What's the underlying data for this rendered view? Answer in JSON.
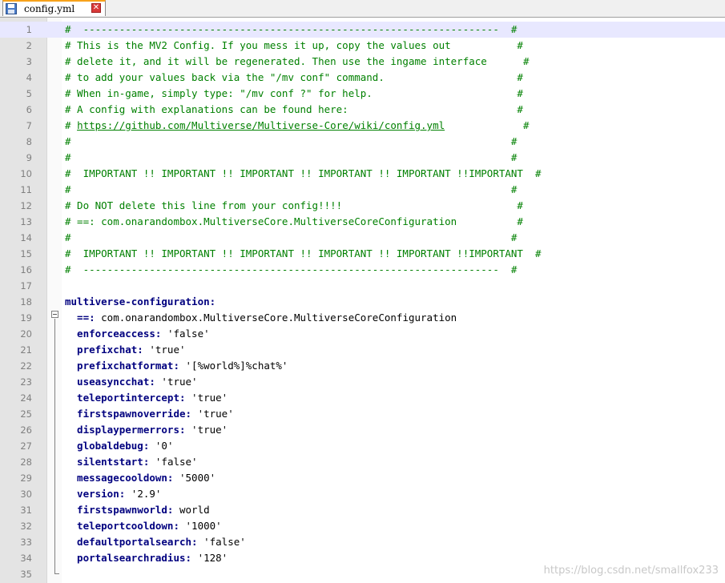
{
  "tab": {
    "filename": "config.yml",
    "close_glyph": "✕"
  },
  "lines": [
    {
      "n": "1",
      "segs": [
        [
          "c",
          "#  ---------------------------------------------------------------------  #"
        ]
      ]
    },
    {
      "n": "2",
      "segs": [
        [
          "c",
          "# This is the MV2 Config. If you mess it up, copy the values out           #"
        ]
      ]
    },
    {
      "n": "3",
      "segs": [
        [
          "c",
          "# delete it, and it will be regenerated. Then use the ingame interface      #"
        ]
      ]
    },
    {
      "n": "4",
      "segs": [
        [
          "c",
          "# to add your values back via the \"/mv conf\" command.                      #"
        ]
      ]
    },
    {
      "n": "5",
      "segs": [
        [
          "c",
          "# When in-game, simply type: \"/mv conf ?\" for help.                        #"
        ]
      ]
    },
    {
      "n": "6",
      "segs": [
        [
          "c",
          "# A config with explanations can be found here:                            #"
        ]
      ]
    },
    {
      "n": "7",
      "segs": [
        [
          "c",
          "# "
        ],
        [
          "link",
          "https://github.com/Multiverse/Multiverse-Core/wiki/config.yml"
        ],
        [
          "c",
          "             #"
        ]
      ]
    },
    {
      "n": "8",
      "segs": [
        [
          "c",
          "#                                                                         #"
        ]
      ]
    },
    {
      "n": "9",
      "segs": [
        [
          "c",
          "#                                                                         #"
        ]
      ]
    },
    {
      "n": "10",
      "segs": [
        [
          "c",
          "#  IMPORTANT !! IMPORTANT !! IMPORTANT !! IMPORTANT !! IMPORTANT !!IMPORTANT  #"
        ]
      ]
    },
    {
      "n": "11",
      "segs": [
        [
          "c",
          "#                                                                         #"
        ]
      ]
    },
    {
      "n": "12",
      "segs": [
        [
          "c",
          "# Do NOT delete this line from your config!!!!                             #"
        ]
      ]
    },
    {
      "n": "13",
      "segs": [
        [
          "c",
          "# ==: com.onarandombox.MultiverseCore.MultiverseCoreConfiguration          #"
        ]
      ]
    },
    {
      "n": "14",
      "segs": [
        [
          "c",
          "#                                                                         #"
        ]
      ]
    },
    {
      "n": "15",
      "segs": [
        [
          "c",
          "#  IMPORTANT !! IMPORTANT !! IMPORTANT !! IMPORTANT !! IMPORTANT !!IMPORTANT  #"
        ]
      ]
    },
    {
      "n": "16",
      "segs": [
        [
          "c",
          "#  ---------------------------------------------------------------------  #"
        ]
      ]
    },
    {
      "n": "17",
      "segs": []
    },
    {
      "n": "18",
      "segs": [
        [
          "k",
          "multiverse-configuration:"
        ]
      ]
    },
    {
      "n": "19",
      "segs": [
        [
          "k",
          "  ==: "
        ],
        [
          "v",
          "com.onarandombox.MultiverseCore.MultiverseCoreConfiguration"
        ]
      ]
    },
    {
      "n": "20",
      "segs": [
        [
          "k",
          "  enforceaccess: "
        ],
        [
          "v",
          "'false'"
        ]
      ]
    },
    {
      "n": "21",
      "segs": [
        [
          "k",
          "  prefixchat: "
        ],
        [
          "v",
          "'true'"
        ]
      ]
    },
    {
      "n": "22",
      "segs": [
        [
          "k",
          "  prefixchatformat: "
        ],
        [
          "v",
          "'[%world%]%chat%'"
        ]
      ]
    },
    {
      "n": "23",
      "segs": [
        [
          "k",
          "  useasyncchat: "
        ],
        [
          "v",
          "'true'"
        ]
      ]
    },
    {
      "n": "24",
      "segs": [
        [
          "k",
          "  teleportintercept: "
        ],
        [
          "v",
          "'true'"
        ]
      ]
    },
    {
      "n": "25",
      "segs": [
        [
          "k",
          "  firstspawnoverride: "
        ],
        [
          "v",
          "'true'"
        ]
      ]
    },
    {
      "n": "26",
      "segs": [
        [
          "k",
          "  displaypermerrors: "
        ],
        [
          "v",
          "'true'"
        ]
      ]
    },
    {
      "n": "27",
      "segs": [
        [
          "k",
          "  globaldebug: "
        ],
        [
          "v",
          "'0'"
        ]
      ]
    },
    {
      "n": "28",
      "segs": [
        [
          "k",
          "  silentstart: "
        ],
        [
          "v",
          "'false'"
        ]
      ]
    },
    {
      "n": "29",
      "segs": [
        [
          "k",
          "  messagecooldown: "
        ],
        [
          "v",
          "'5000'"
        ]
      ]
    },
    {
      "n": "30",
      "segs": [
        [
          "k",
          "  version: "
        ],
        [
          "v",
          "'2.9'"
        ]
      ]
    },
    {
      "n": "31",
      "segs": [
        [
          "k",
          "  firstspawnworld: "
        ],
        [
          "v",
          "world"
        ]
      ]
    },
    {
      "n": "32",
      "segs": [
        [
          "k",
          "  teleportcooldown: "
        ],
        [
          "v",
          "'1000'"
        ]
      ]
    },
    {
      "n": "33",
      "segs": [
        [
          "k",
          "  defaultportalsearch: "
        ],
        [
          "v",
          "'false'"
        ]
      ]
    },
    {
      "n": "34",
      "segs": [
        [
          "k",
          "  portalsearchradius: "
        ],
        [
          "v",
          "'128'"
        ]
      ]
    },
    {
      "n": "35",
      "segs": []
    }
  ],
  "current_line": "1",
  "watermark": "https://blog.csdn.net/smallfox233",
  "colors": {
    "comment": "#008000",
    "key": "#00007f",
    "value": "#000000",
    "current_line": "#e8e8ff",
    "gutter": "#e4e4e4"
  }
}
